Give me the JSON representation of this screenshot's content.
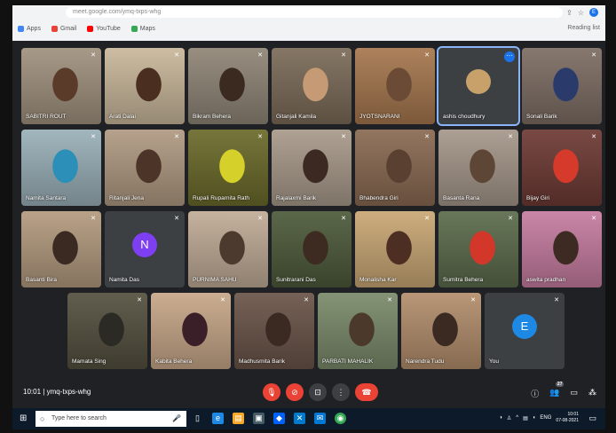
{
  "browser": {
    "url": "meet.google.com/ymq-txps-whg",
    "bookmarks": [
      {
        "label": "Apps",
        "color": "#4285f4"
      },
      {
        "label": "Gmail",
        "color": "#ea4335"
      },
      {
        "label": "YouTube",
        "color": "#ff0000"
      },
      {
        "label": "Maps",
        "color": "#34a853"
      }
    ],
    "reading_list": "Reading list",
    "profile_initial": "E"
  },
  "participants": [
    {
      "name": "SABITRI ROUT",
      "bg": "#a0917e",
      "face": "#5a3b2a"
    },
    {
      "name": "Arati Dalai",
      "bg": "#c9b79a",
      "face": "#4a2e1f"
    },
    {
      "name": "Bikram Behera",
      "bg": "#8f8576",
      "face": "#3b2a20"
    },
    {
      "name": "Gitanjali Kamila",
      "bg": "#7b6b58",
      "face": "#c59a74"
    },
    {
      "name": "JYOTSNARANI",
      "bg": "#a6774e",
      "face": "#6b4b36"
    },
    {
      "name": "ashis choudhury",
      "bg": "#3c4043",
      "avatar": "photo",
      "avatar_color": "#c8a06a"
    },
    {
      "name": "Sonali Barik",
      "bg": "#7d6d63",
      "face": "#2a3b6b"
    },
    {
      "name": "Namita Santara",
      "bg": "#9ab0b8",
      "face": "#2b8fb8"
    },
    {
      "name": "Ritanjali Jena",
      "bg": "#b09a82",
      "face": "#4c3528"
    },
    {
      "name": "Rupali Ruparnita Rath",
      "bg": "#6b6a2a",
      "face": "#d6d02a"
    },
    {
      "name": "Rajalaxmi Barik",
      "bg": "#a89a8a",
      "face": "#3c2a22"
    },
    {
      "name": "Bhabendra Giri",
      "bg": "#8a6a52",
      "face": "#5a4030"
    },
    {
      "name": "Basanta Rana",
      "bg": "#a5978a",
      "face": "#5d4636"
    },
    {
      "name": "Bijay Giri",
      "bg": "#6e3a34",
      "face": "#d63a2a"
    },
    {
      "name": "Basanti Bira",
      "bg": "#b39a7e",
      "face": "#3a2a22"
    },
    {
      "name": "Namita Das",
      "bg": "#3c4043",
      "avatar": "N",
      "avatar_color": "#7e3ff2"
    },
    {
      "name": "PURNIMA SAHU",
      "bg": "#c0ab96",
      "face": "#4d3a2e"
    },
    {
      "name": "Sunitrarani Das",
      "bg": "#4d5a3a",
      "face": "#3d2a20"
    },
    {
      "name": "Monalisha Kar",
      "bg": "#c9a774",
      "face": "#4c2f22"
    },
    {
      "name": "Sumitra Behera",
      "bg": "#5b6b4b",
      "face": "#d3372a"
    },
    {
      "name": "aswita pradhan",
      "bg": "#c67ca0",
      "face": "#3d2a22"
    },
    {
      "name": "Mamata Sing",
      "bg": "#54503f",
      "face": "#2c2a24"
    },
    {
      "name": "Kabita Behera",
      "bg": "#c7a788",
      "face": "#3a1e28"
    },
    {
      "name": "Madhusmita Barik",
      "bg": "#6a5448",
      "face": "#3a2a22"
    },
    {
      "name": "PARBATI MAHALIK",
      "bg": "#7a8a6a",
      "face": "#4b3a2b"
    },
    {
      "name": "Narendra Tudu",
      "bg": "#b38e6c",
      "face": "#3a2a22"
    },
    {
      "name": "You",
      "bg": "#3c4043",
      "avatar": "E",
      "avatar_color": "#1e88e5"
    }
  ],
  "meet": {
    "time": "10:01",
    "code": "ymq-txps-whg",
    "participant_count": "27"
  },
  "taskbar": {
    "search_placeholder": "Type here to search",
    "lang": "ENG",
    "time": "10:01",
    "date": "07-08-2021"
  }
}
